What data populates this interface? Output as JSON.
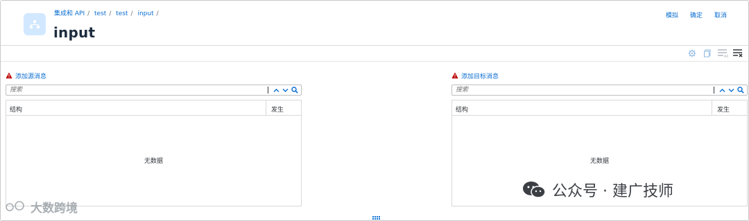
{
  "header": {
    "breadcrumbs": [
      "集成和 API",
      "test",
      "test",
      "input"
    ],
    "title": "input",
    "actions": {
      "simulate": "模拟",
      "confirm": "确定",
      "cancel": "取消"
    }
  },
  "left_panel": {
    "title": "添加源消息",
    "search_placeholder": "搜索",
    "columns": [
      "结构",
      "发生"
    ],
    "empty_text": "无数据"
  },
  "right_panel": {
    "title": "添加目标消息",
    "search_placeholder": "搜索",
    "columns": [
      "结构",
      "发生"
    ],
    "empty_text": "无数据"
  },
  "watermarks": {
    "left": "大数跨境",
    "right": "公众号 · 建广技师"
  },
  "colors": {
    "accent": "#0a6ed1",
    "warning": "#bb0000",
    "icon_bg": "#d1e8ff"
  }
}
